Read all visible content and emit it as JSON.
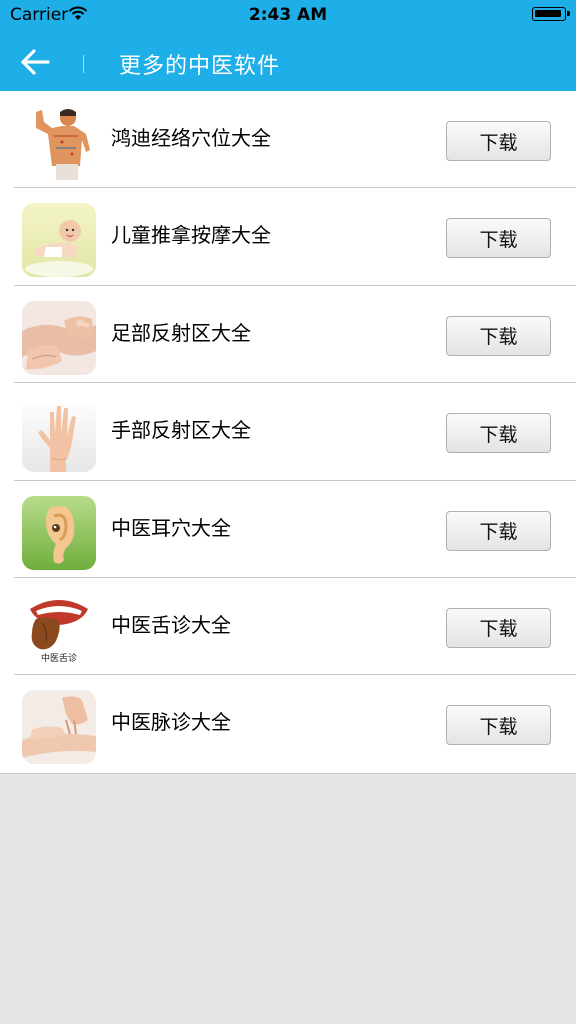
{
  "status_bar": {
    "carrier": "Carrier",
    "time": "2:43 AM"
  },
  "nav": {
    "title": "更多的中医软件"
  },
  "apps": [
    {
      "name": "鸿迪经络穴位大全",
      "button": "下载",
      "icon": "meridian-figure-icon"
    },
    {
      "name": "儿童推拿按摩大全",
      "button": "下载",
      "icon": "baby-icon"
    },
    {
      "name": "足部反射区大全",
      "button": "下载",
      "icon": "foot-massage-icon"
    },
    {
      "name": "手部反射区大全",
      "button": "下载",
      "icon": "hand-icon"
    },
    {
      "name": "中医耳穴大全",
      "button": "下载",
      "icon": "ear-icon"
    },
    {
      "name": "中医舌诊大全",
      "button": "下载",
      "icon": "tongue-icon",
      "icon_caption": "中医舌诊"
    },
    {
      "name": "中医脉诊大全",
      "button": "下载",
      "icon": "pulse-diagnosis-icon"
    }
  ],
  "colors": {
    "header": "#1eaee8",
    "background": "#e6e6e6"
  }
}
